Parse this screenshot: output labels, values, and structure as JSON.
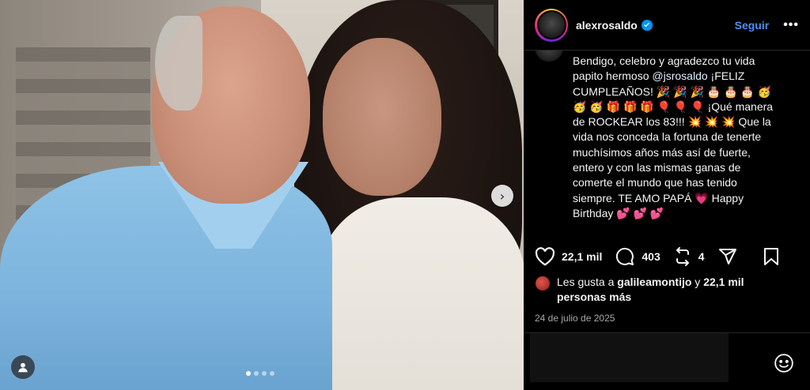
{
  "post": {
    "author": "alexrosaldo",
    "verified": true,
    "follow_label": "Seguir",
    "more_label": "•••",
    "carousel": {
      "total": 4,
      "active": 1
    }
  },
  "caption": {
    "line1": "Bendigo, celebro y agradezco tu vida",
    "line2a": "papito hermoso ",
    "mention": "@jsrosaldo",
    "line2b": " ¡FELIZ",
    "line3": "CUMPLEAÑOS! 🎉 🎉 🎉 🎂 🎂 🎂 🥳",
    "line4": "🥳 🥳 🎁 🎁 🎁 🎈 🎈 🎈 ¡Qué manera",
    "line5": "de ROCKEAR los 83!!! 💥 💥 💥  Que la",
    "line6": "vida nos conceda la fortuna de tenerte",
    "line7": "muchísimos años más así de fuerte,",
    "line8": "entero y con las mismas ganas de",
    "line9": "comerte el mundo que has tenido",
    "line10": "siempre. TE AMO PAPÁ 💗  Happy",
    "line11": "Birthday 💕 💕 💕"
  },
  "actions": {
    "likes_count": "22,1 mil",
    "comments_count": "403",
    "reposts_count": "4"
  },
  "likes_text": {
    "prefix": "Les gusta a ",
    "user": "galileamontijo",
    "middle": " y ",
    "count": "22,1 mil",
    "suffix_line": "personas más"
  },
  "date": "24 de julio de 2025",
  "icons": {
    "heart": "heart-icon",
    "comment": "comment-icon",
    "repost": "repost-icon",
    "share": "share-icon",
    "save": "bookmark-icon",
    "emoji": "emoji-icon",
    "tag": "user-tag-icon",
    "next": "chevron-right-icon",
    "verified": "verified-badge-icon"
  },
  "colors": {
    "accent": "#4f8ff7",
    "verified": "#0095f6",
    "mention": "#e0f1ff"
  }
}
